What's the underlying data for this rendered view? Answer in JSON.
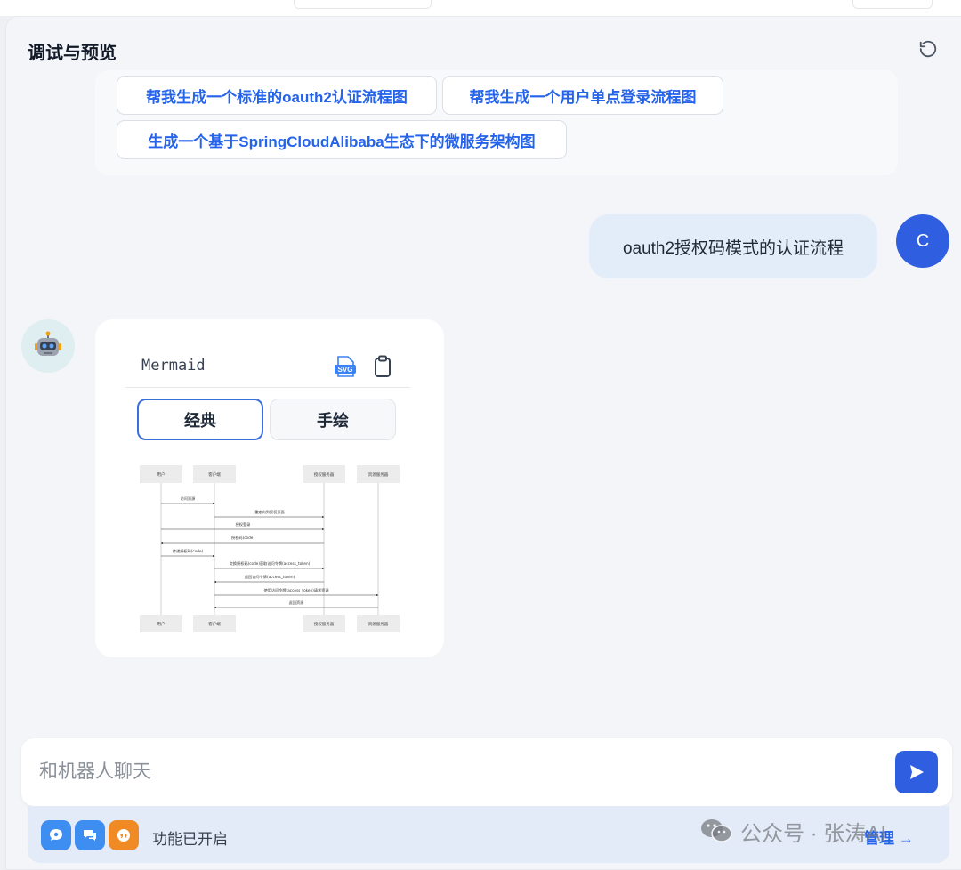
{
  "panel": {
    "title": "调试与预览"
  },
  "suggestions": [
    "帮我生成一个标准的oauth2认证流程图",
    "帮我生成一个用户单点登录流程图",
    "生成一个基于SpringCloudAlibaba生态下的微服务架构图"
  ],
  "user_message": {
    "text": "oauth2授权码模式的认证流程",
    "avatar_letter": "C"
  },
  "bot_message": {
    "avatar_icon": "robot-icon",
    "code_lang": "Mermaid",
    "svg_badge": "SVG",
    "tabs": [
      "经典",
      "手绘"
    ],
    "active_tab": "经典",
    "diagram": {
      "actors": [
        "用户",
        "客户端",
        "授权服务器",
        "资源服务器"
      ],
      "messages": [
        "访问资源",
        "重定向到授权页面",
        "授权登录",
        "授权码(code)",
        "传递授权码(code)",
        "交换授权码(code)获取访问令牌(access_token)",
        "返回访问令牌(access_token)",
        "使用访问令牌(access_token)请求资源",
        "返回资源"
      ]
    }
  },
  "composer": {
    "placeholder": "和机器人聊天"
  },
  "footer": {
    "status": "功能已开启",
    "manage": "管理 →"
  },
  "watermark": {
    "text": "公众号 · 张涛AI"
  },
  "colors": {
    "accent": "#2f5fe0",
    "link": "#2563eb",
    "feature_blue": "#3d8ef0",
    "feature_orange": "#f08a24"
  }
}
